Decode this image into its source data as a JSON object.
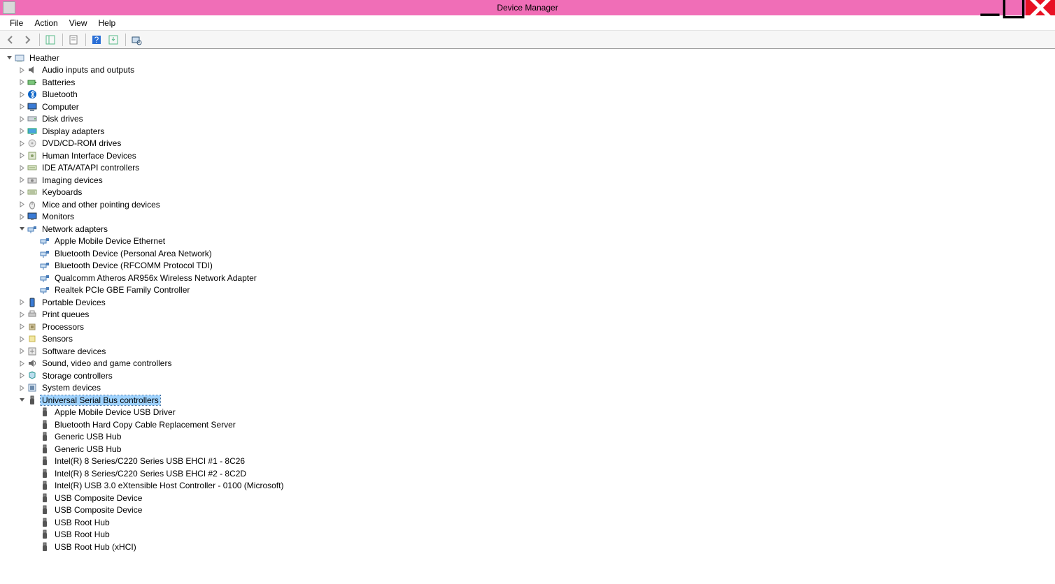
{
  "window": {
    "title": "Device Manager"
  },
  "menu": {
    "file": "File",
    "action": "Action",
    "view": "View",
    "help": "Help"
  },
  "tree": {
    "root": "Heather",
    "categories": [
      {
        "label": "Audio inputs and outputs",
        "icon": "audio",
        "expanded": false
      },
      {
        "label": "Batteries",
        "icon": "battery",
        "expanded": false
      },
      {
        "label": "Bluetooth",
        "icon": "bluetooth",
        "expanded": false
      },
      {
        "label": "Computer",
        "icon": "computer",
        "expanded": false
      },
      {
        "label": "Disk drives",
        "icon": "disk",
        "expanded": false
      },
      {
        "label": "Display adapters",
        "icon": "display",
        "expanded": false
      },
      {
        "label": "DVD/CD-ROM drives",
        "icon": "cdrom",
        "expanded": false
      },
      {
        "label": "Human Interface Devices",
        "icon": "hid",
        "expanded": false
      },
      {
        "label": "IDE ATA/ATAPI controllers",
        "icon": "ide",
        "expanded": false
      },
      {
        "label": "Imaging devices",
        "icon": "imaging",
        "expanded": false
      },
      {
        "label": "Keyboards",
        "icon": "keyboard",
        "expanded": false
      },
      {
        "label": "Mice and other pointing devices",
        "icon": "mouse",
        "expanded": false
      },
      {
        "label": "Monitors",
        "icon": "monitor",
        "expanded": false
      },
      {
        "label": "Network adapters",
        "icon": "network",
        "expanded": true,
        "selected": false,
        "children": [
          {
            "label": "Apple Mobile Device Ethernet",
            "icon": "network"
          },
          {
            "label": "Bluetooth Device (Personal Area Network)",
            "icon": "network"
          },
          {
            "label": "Bluetooth Device (RFCOMM Protocol TDI)",
            "icon": "network"
          },
          {
            "label": "Qualcomm Atheros AR956x Wireless Network Adapter",
            "icon": "network"
          },
          {
            "label": "Realtek PCIe GBE Family Controller",
            "icon": "network"
          }
        ]
      },
      {
        "label": "Portable Devices",
        "icon": "portable",
        "expanded": false
      },
      {
        "label": "Print queues",
        "icon": "printer",
        "expanded": false
      },
      {
        "label": "Processors",
        "icon": "cpu",
        "expanded": false
      },
      {
        "label": "Sensors",
        "icon": "sensor",
        "expanded": false
      },
      {
        "label": "Software devices",
        "icon": "software",
        "expanded": false
      },
      {
        "label": "Sound, video and game controllers",
        "icon": "sound",
        "expanded": false
      },
      {
        "label": "Storage controllers",
        "icon": "storage",
        "expanded": false
      },
      {
        "label": "System devices",
        "icon": "system",
        "expanded": false
      },
      {
        "label": "Universal Serial Bus controllers",
        "icon": "usb",
        "expanded": true,
        "selected": true,
        "children": [
          {
            "label": "Apple Mobile Device USB Driver",
            "icon": "usb"
          },
          {
            "label": "Bluetooth Hard Copy Cable Replacement Server",
            "icon": "usb"
          },
          {
            "label": "Generic USB Hub",
            "icon": "usb"
          },
          {
            "label": "Generic USB Hub",
            "icon": "usb"
          },
          {
            "label": "Intel(R) 8 Series/C220 Series  USB EHCI #1 - 8C26",
            "icon": "usb"
          },
          {
            "label": "Intel(R) 8 Series/C220 Series  USB EHCI #2 - 8C2D",
            "icon": "usb"
          },
          {
            "label": "Intel(R) USB 3.0 eXtensible Host Controller - 0100 (Microsoft)",
            "icon": "usb"
          },
          {
            "label": "USB Composite Device",
            "icon": "usb"
          },
          {
            "label": "USB Composite Device",
            "icon": "usb"
          },
          {
            "label": "USB Root Hub",
            "icon": "usb"
          },
          {
            "label": "USB Root Hub",
            "icon": "usb"
          },
          {
            "label": "USB Root Hub (xHCI)",
            "icon": "usb"
          }
        ]
      }
    ]
  }
}
